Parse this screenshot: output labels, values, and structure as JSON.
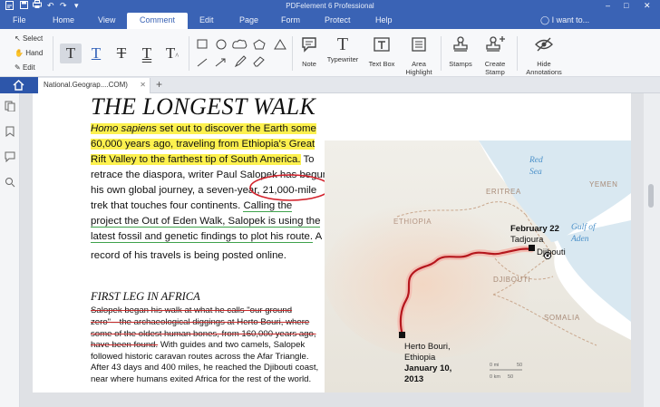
{
  "titlebar": {
    "title": "PDFelement 6 Professional"
  },
  "menu": {
    "items": [
      "File",
      "Home",
      "View",
      "Comment",
      "Edit",
      "Page",
      "Form",
      "Protect",
      "Help"
    ],
    "active": "Comment",
    "iwant": "I want to..."
  },
  "ribbon": {
    "select_tools": [
      "Select",
      "Hand",
      "Edit"
    ],
    "buttons": {
      "note": "Note",
      "typewriter": "Typewriter",
      "textbox": "Text Box",
      "area_highlight": [
        "Area",
        "Highlight"
      ],
      "stamps": "Stamps",
      "create_stamp": [
        "Create",
        "Stamp"
      ],
      "hide_annotations": [
        "Hide",
        "Annotations"
      ]
    }
  },
  "tabs": {
    "doc_tab": "National.Geograp....COM)",
    "add": "+"
  },
  "icons": {
    "home": "home-icon",
    "sidebar": [
      "pages-icon",
      "bookmark-icon",
      "comment-icon",
      "search-icon"
    ]
  },
  "colors": {
    "accent": "#3a63b5",
    "highlight": "#fdf14e",
    "underline": "#3fa24c",
    "ink": "#c62b2b"
  },
  "document": {
    "headline": "THE LONGEST WALK",
    "intro": {
      "l1a": "Homo sapiens",
      "l1b": " set out to discover the Earth some",
      "l2": "60,000 years ago, traveling from Ethiopia's Great",
      "l3a": "Rift Valley to the farthest tip of South America.",
      "l3b": " To",
      "l4": "retrace the diaspora, writer Paul Salopek has begun",
      "l5a": "his own global journey, a seven-year, ",
      "l5b": "21,000-mile",
      "l6a": "trek that touches four continents. ",
      "l6b": "Calling the",
      "l7": "project the Out of Eden Walk, Salopek is using the",
      "l8a": "latest fossil and genetic findings to plot his route.",
      "l8b": " A",
      "l9": "record of his travels is being posted online."
    },
    "subhead": "FIRST LEG IN AFRICA",
    "body": {
      "b1": "Salopek began his walk at what he calls \"our ground",
      "b2": "zero\"—the archaeological diggings at Herto Bouri, where",
      "b3": "some of the oldest human bones, from 160,000 years ago,",
      "b4a": "have been found.",
      "b4b": " With guides and two camels, Salopek",
      "b5": "followed historic caravan routes across the Afar Triangle.",
      "b6": "After 43 days and 400 miles, he reached the Djibouti coast,",
      "b7": "near where humans exited Africa for the rest of the world."
    },
    "map": {
      "red_sea": [
        "Red",
        "Sea"
      ],
      "eritrea": "ERITREA",
      "yemen": "YEMEN",
      "ethiopia": "ETHIOPIA",
      "gulf": [
        "Gulf of",
        "Aden"
      ],
      "end_date": "February 22",
      "end_place": "Tadjoura",
      "djibouti_city": "Djibouti",
      "djibouti_country": "DJIBOUTI",
      "somalia": "SOMALIA",
      "start_place": [
        "Herto Bouri,",
        "Ethiopia"
      ],
      "start_date": [
        "January 10,",
        "2013"
      ],
      "scale_mi": [
        "0 mi",
        "50"
      ],
      "scale_km": [
        "0 km",
        "50"
      ]
    }
  }
}
